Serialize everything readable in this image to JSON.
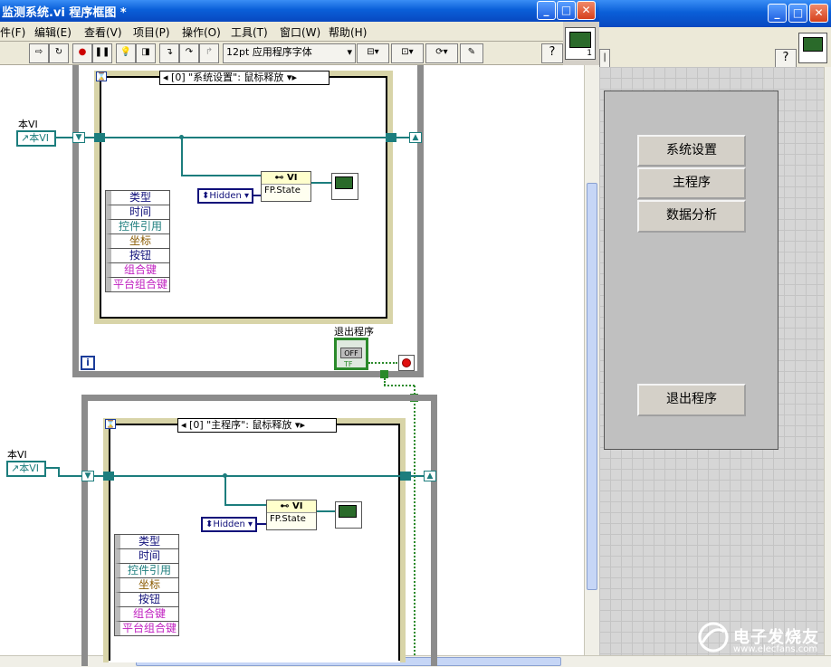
{
  "diagram_window": {
    "title": "监测系统.vi 程序框图 *",
    "menu": [
      "件(F)",
      "编辑(E)",
      "查看(V)",
      "项目(P)",
      "操作(O)",
      "工具(T)",
      "窗口(W)",
      "帮助(H)"
    ],
    "font_selector": "12pt 应用程序字体",
    "help_glyph": "?",
    "case_structure_1": {
      "selector": "[0] \"系统设置\": 鼠标释放",
      "ref_label": "本VI",
      "ref_terminal": "本VI",
      "enum_value": "Hidden",
      "prop_header": "VI",
      "prop_item": "FP.State",
      "event_items": [
        "类型",
        "时间",
        "控件引用",
        "坐标",
        "按钮",
        "组合键",
        "平台组合键"
      ],
      "while_info_glyph": "i"
    },
    "stop_control": {
      "label": "退出程序",
      "state": "OFF",
      "tf": "TF"
    },
    "case_structure_2": {
      "selector": "[0] \"主程序\": 鼠标释放",
      "ref_label": "本VI",
      "ref_terminal": "本VI",
      "enum_value": "Hidden",
      "prop_header": "VI",
      "prop_item": "FP.State",
      "event_items": [
        "类型",
        "时间",
        "控件引用",
        "坐标",
        "按钮",
        "组合键",
        "平台组合键"
      ]
    },
    "vi_icon_badge": "1"
  },
  "front_panel_window": {
    "help_glyph": "?",
    "buttons": {
      "system_setup": "系统设置",
      "main_program": "主程序",
      "data_analysis": "数据分析",
      "exit_program": "退出程序"
    }
  },
  "watermark": {
    "brand": "电子发烧友",
    "url": "www.elecfans.com"
  },
  "colors": {
    "wire": "#1c7d7d",
    "titlebar": "#0a5fd8",
    "enum": "#10107a"
  }
}
